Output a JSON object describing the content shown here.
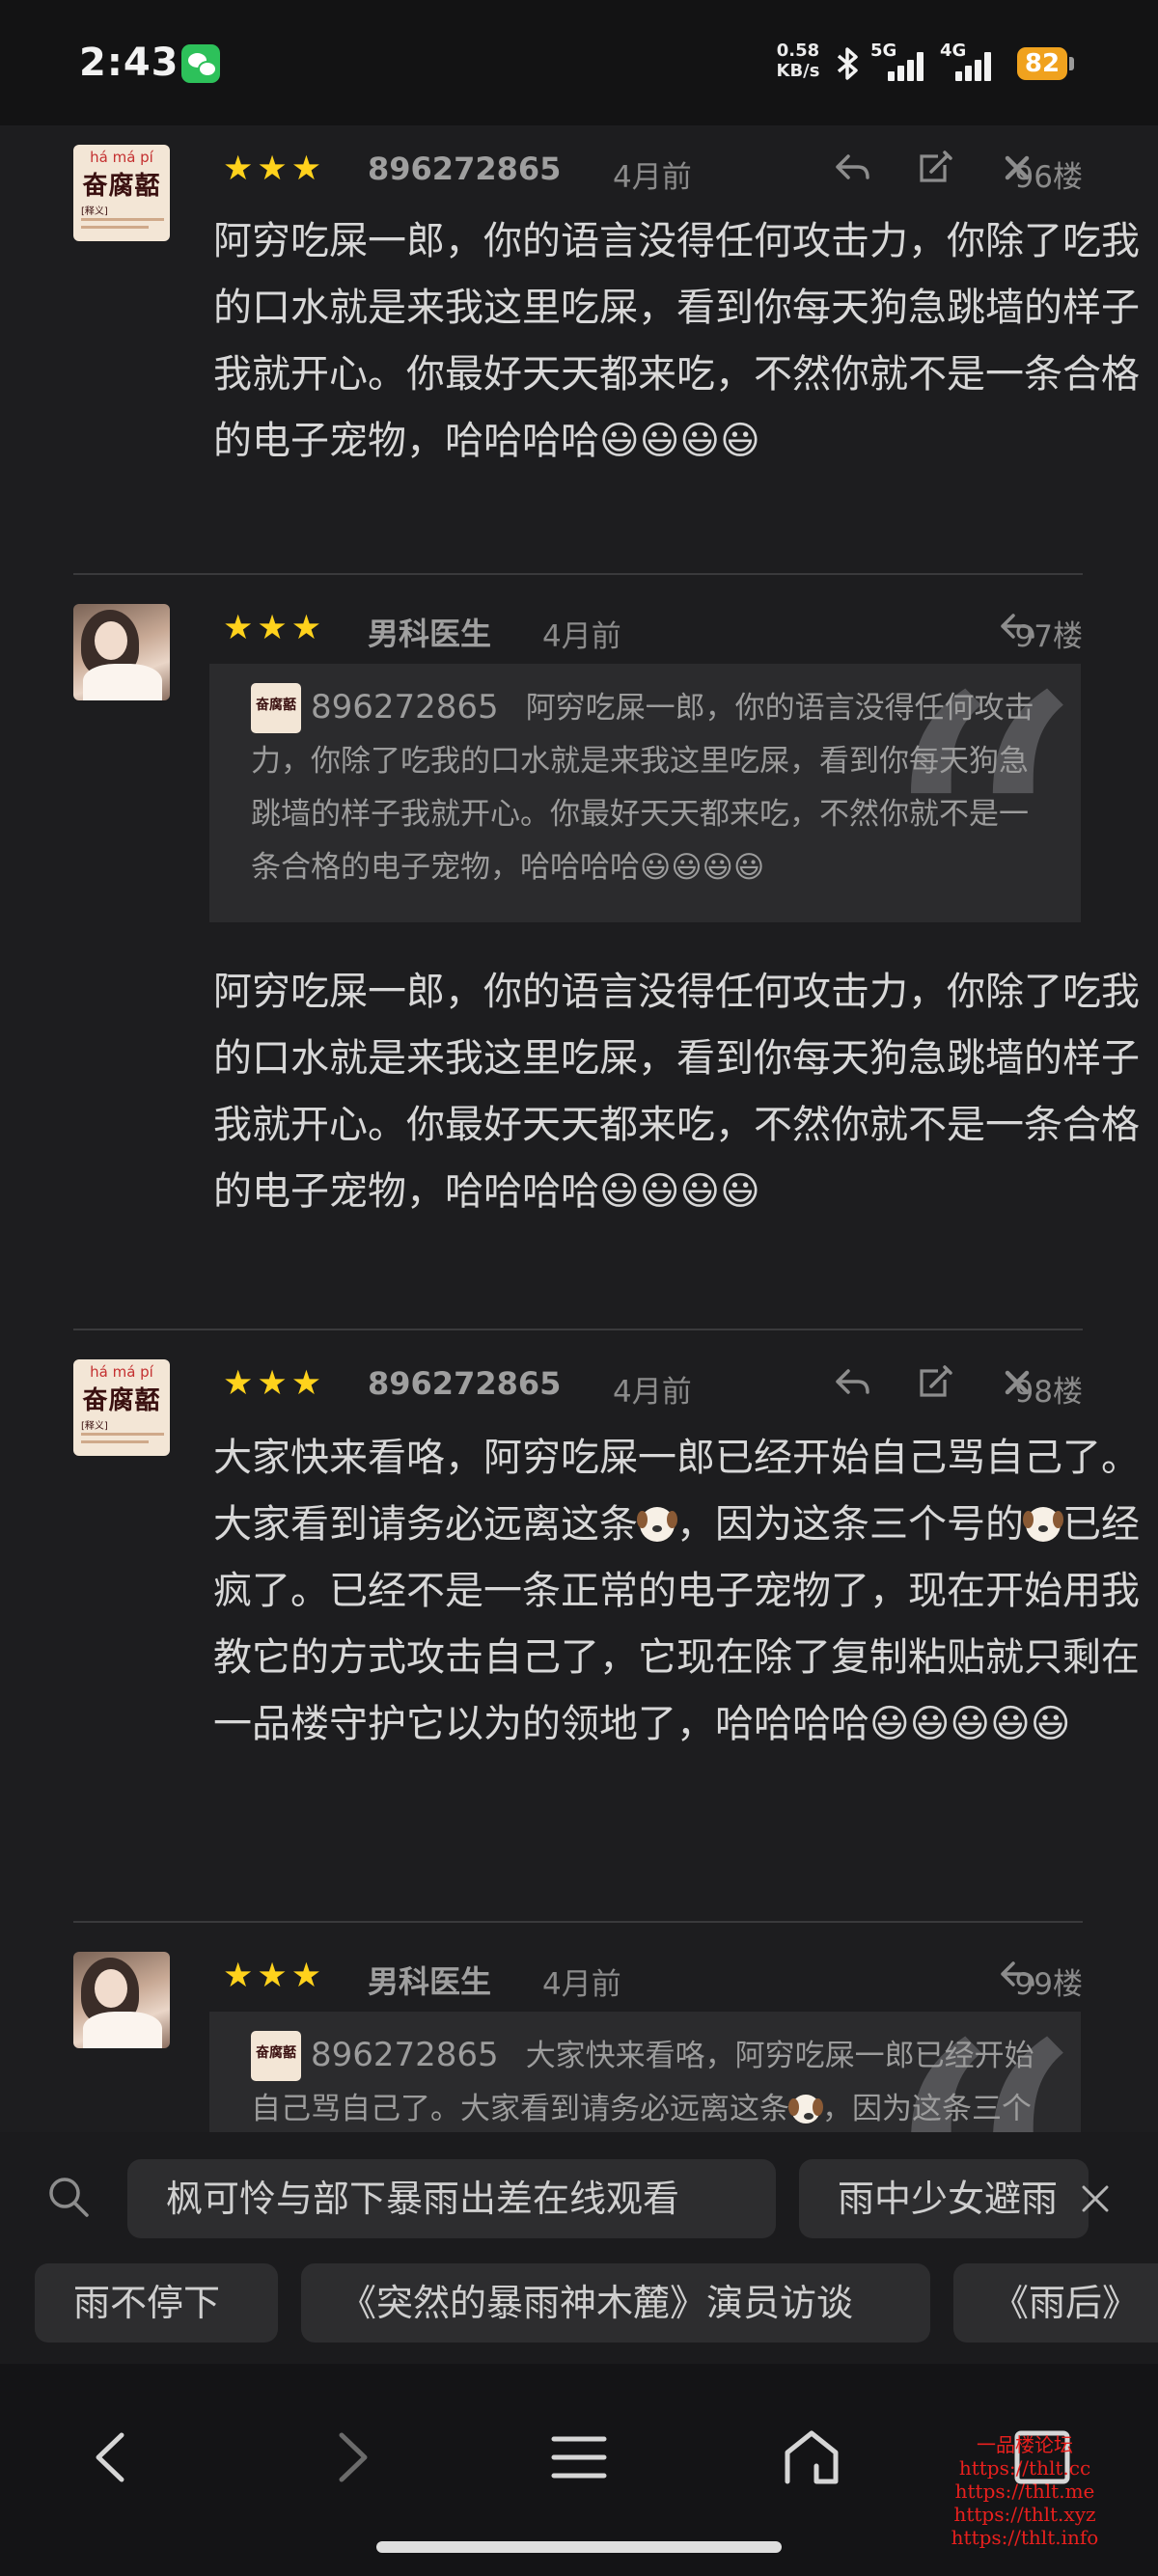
{
  "status_bar": {
    "time": "2:43",
    "net_speed_value": "0.58",
    "net_speed_unit": "KB/s",
    "signal1_label": "5G",
    "signal2_label": "4G",
    "battery": "82"
  },
  "posts": [
    {
      "avatar_pinyin": "há má pí",
      "avatar_text": "奋腐嚭",
      "avatar_sub": "[释义]",
      "stars": 3,
      "username": "896272865",
      "time": "4月前",
      "floor": "96楼",
      "content": "阿穷吃屎一郎，你的语言没得任何攻击力，你除了吃我的口水就是来我这里吃屎，看到你每天狗急跳墙的样子我就开心。你最好天天都来吃，不然你就不是一条合格的电子宠物，哈哈哈哈😃😃😃😃"
    },
    {
      "stars": 3,
      "username": "男科医生",
      "time": "4月前",
      "floor": "97楼",
      "quote": {
        "avatar_text": "奋腐嚭",
        "username": "896272865",
        "text": "阿穷吃屎一郎，你的语言没得任何攻击力，你除了吃我的口水就是来我这里吃屎，看到你每天狗急跳墙的样子我就开心。你最好天天都来吃，不然你就不是一条合格的电子宠物，哈哈哈哈😃😃😃😃"
      },
      "content": "阿穷吃屎一郎，你的语言没得任何攻击力，你除了吃我的口水就是来我这里吃屎，看到你每天狗急跳墙的样子我就开心。你最好天天都来吃，不然你就不是一条合格的电子宠物，哈哈哈哈😃😃😃😃"
    },
    {
      "avatar_pinyin": "há má pí",
      "avatar_text": "奋腐嚭",
      "avatar_sub": "[释义]",
      "stars": 3,
      "username": "896272865",
      "time": "4月前",
      "floor": "98楼",
      "content_parts": [
        "大家快来看咯，阿穷吃屎一郎已经开始自己骂自己了。大家看到请务必远离这条",
        "，因为这条三个号的",
        "已经疯了。已经不是一条正常的电子宠物了，现在开始用我教它的方式攻击自己了，它现在除了复制粘贴就只剩在一品楼守护它以为的领地了，哈哈哈哈😃😃😃😃😃"
      ]
    },
    {
      "stars": 3,
      "username": "男科医生",
      "time": "4月前",
      "floor": "99楼",
      "quote": {
        "avatar_text": "奋腐嚭",
        "username": "896272865",
        "text_parts": [
          "大家快来看咯，阿穷吃屎一郎已经开始自己骂自己了。大家看到请务必远离这条",
          "，因为这条三个号的"
        ]
      }
    }
  ],
  "suggestions": {
    "row1": [
      "枫可怜与部下暴雨出差在线观看",
      "雨中少女避雨"
    ],
    "row2": [
      "雨不停下",
      "《突然的暴雨神木麓》演员访谈",
      "《雨后》"
    ]
  },
  "watermark_lines": [
    "一品楼论坛",
    "https://thlt.cc",
    "https://thlt.me",
    "https://thlt.xyz",
    "https://thlt.info"
  ],
  "colors": {
    "background": "#1d1d1f",
    "star": "#ffd21c",
    "battery": "#f0a21e",
    "wechat": "#2dc15a",
    "watermark": "#e8201e"
  }
}
